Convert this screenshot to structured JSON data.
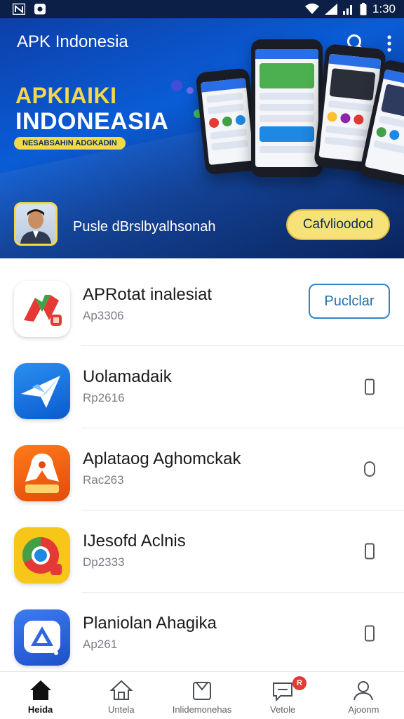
{
  "status_bar": {
    "time": "1:30",
    "left_icons": [
      "notification-n-icon",
      "notification-app-icon"
    ],
    "right_icons": [
      "wifi-icon",
      "signal-icon",
      "signal-bars-icon",
      "battery-icon"
    ]
  },
  "header": {
    "title": "APK Indonesia",
    "icons": [
      "search-icon",
      "more-vert-icon"
    ]
  },
  "banner": {
    "headline_line1": "APKIAIKI",
    "headline_line2": "INDONEASIA",
    "tagline": "NESABSAHIN ADGKADIN",
    "promo_text": "Pusle dBrslbyalhsonah",
    "cta_label": "Cafvlioodod",
    "colors": {
      "accent_yellow": "#f3d94a",
      "banner_blue": "#0a5cd6"
    }
  },
  "apps": [
    {
      "name": "APRotat inalesiat",
      "sub": "Ap3306",
      "action": "Puclclar",
      "icon": "red-green-n-logo-icon"
    },
    {
      "name": "Uolamadaik",
      "sub": "Rp2616",
      "action": "",
      "icon": "blue-paper-plane-icon"
    },
    {
      "name": "Aplataog Aghomckak",
      "sub": "Rac263",
      "action": "",
      "icon": "orange-app-logo-icon"
    },
    {
      "name": "IJesofd Aclnis",
      "sub": "Dp2333",
      "action": "",
      "icon": "yellow-chrome-style-icon"
    },
    {
      "name": "Planiolan Ahagika",
      "sub": "Ap261",
      "action": "",
      "icon": "blue-triangle-logo-icon"
    }
  ],
  "bottom_nav": {
    "items": [
      {
        "label": "Heida",
        "icon": "home-icon",
        "active": true
      },
      {
        "label": "Untela",
        "icon": "home-outline-icon",
        "active": false
      },
      {
        "label": "Inlidemonehas",
        "icon": "inbox-icon",
        "active": false
      },
      {
        "label": "Vetole",
        "icon": "message-icon",
        "active": false,
        "badge": "R"
      },
      {
        "label": "Ajoonm",
        "icon": "person-icon",
        "active": false
      }
    ]
  }
}
